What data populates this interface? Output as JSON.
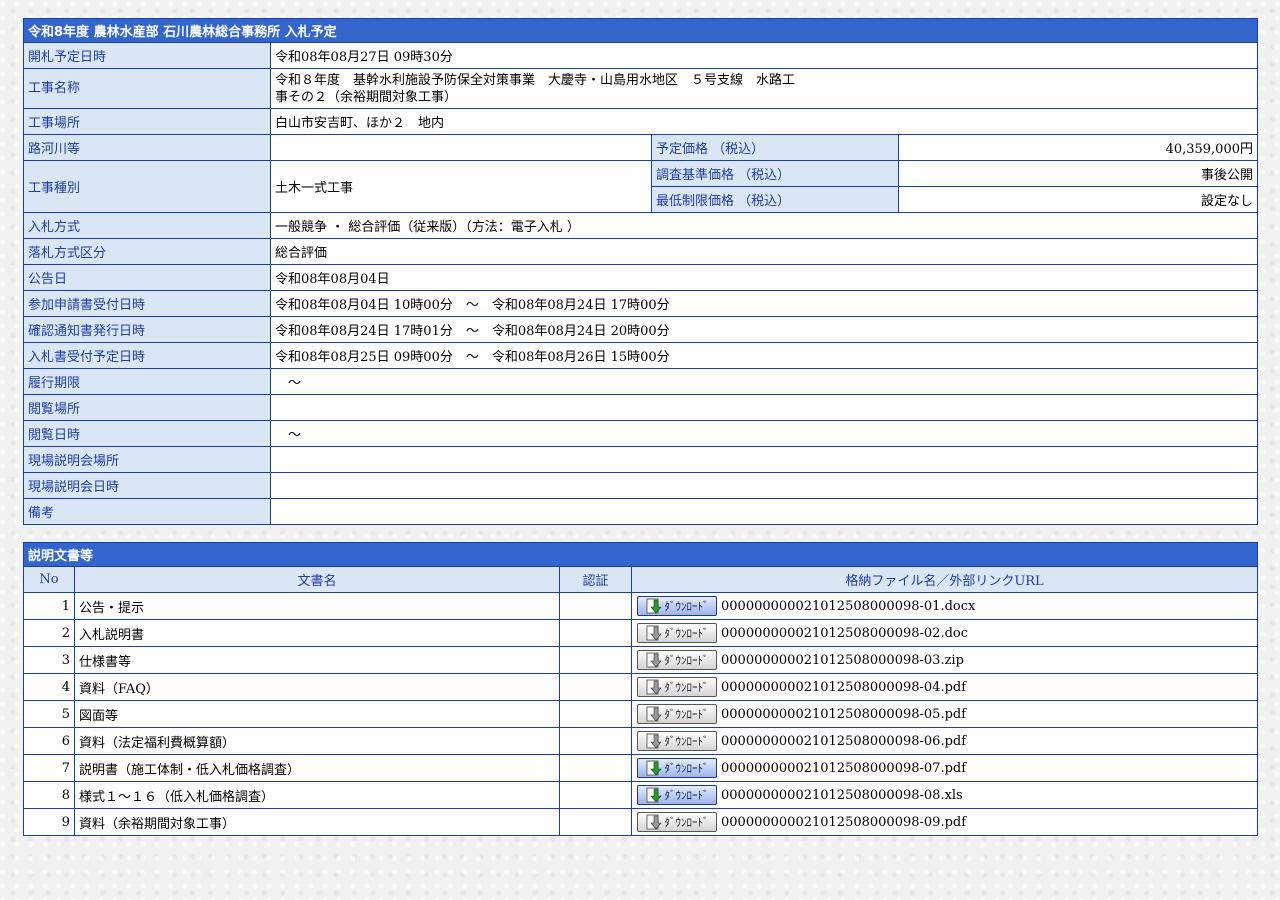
{
  "summary": {
    "title": "令和8年度 農林水産部 石川農林総合事務所 入札予定",
    "rows": {
      "opening": {
        "label": "開札予定日時",
        "value": "令和08年08月27日 09時30分"
      },
      "name": {
        "label": "工事名称",
        "value_line1": "令和８年度　基幹水利施設予防保全対策事業　大慶寺・山島用水地区　５号支線　水路工",
        "value_line2": "事その２（余裕期間対象工事）"
      },
      "place": {
        "label": "工事場所",
        "value": "白山市安吉町、ほか２　地内"
      },
      "river": {
        "label": "路河川等",
        "value": ""
      },
      "type": {
        "label": "工事種別",
        "value": "土木一式工事"
      },
      "price_est": {
        "label": "予定価格 （税込）",
        "value": "40,359,000円"
      },
      "price_survey": {
        "label": "調査基準価格 （税込）",
        "value": "事後公開"
      },
      "price_min": {
        "label": "最低制限価格 （税込）",
        "value": "設定なし"
      },
      "method": {
        "label": "入札方式",
        "value": "一般競争 ・ 総合評価（従来版）（方法：電子入札 ）"
      },
      "award": {
        "label": "落札方式区分",
        "value": "総合評価"
      },
      "notice": {
        "label": "公告日",
        "value": "令和08年08月04日"
      },
      "apply": {
        "label": "参加申請書受付日時",
        "value": "令和08年08月04日 10時00分　～　令和08年08月24日 17時00分"
      },
      "confirm": {
        "label": "確認通知書発行日時",
        "value": "令和08年08月24日 17時01分　～　令和08年08月24日 20時00分"
      },
      "receipt": {
        "label": "入札書受付予定日時",
        "value": "令和08年08月25日 09時00分　～　令和08年08月26日 15時00分"
      },
      "period": {
        "label": "履行期限",
        "value": "　～"
      },
      "view_place": {
        "label": "閲覧場所",
        "value": ""
      },
      "view_date": {
        "label": "閲覧日時",
        "value": "　～"
      },
      "site_place": {
        "label": "現場説明会場所",
        "value": ""
      },
      "site_date": {
        "label": "現場説明会日時",
        "value": ""
      },
      "note": {
        "label": "備考",
        "value": ""
      }
    }
  },
  "docs": {
    "title": "説明文書等",
    "headers": {
      "no": "No",
      "name": "文書名",
      "cert": "認証",
      "file": "格納ファイル名／外部リンクURL"
    },
    "download_label": "ﾀﾞｳﾝﾛｰﾄﾞ",
    "items": [
      {
        "no": "1",
        "name": "公告・提示",
        "file": "000000000021012508000098-01.docx",
        "active": true
      },
      {
        "no": "2",
        "name": "入札説明書",
        "file": "000000000021012508000098-02.doc",
        "active": false
      },
      {
        "no": "3",
        "name": "仕様書等",
        "file": "000000000021012508000098-03.zip",
        "active": false
      },
      {
        "no": "4",
        "name": "資料（FAQ）",
        "file": "000000000021012508000098-04.pdf",
        "active": false
      },
      {
        "no": "5",
        "name": "図面等",
        "file": "000000000021012508000098-05.pdf",
        "active": false
      },
      {
        "no": "6",
        "name": "資料（法定福利費概算額）",
        "file": "000000000021012508000098-06.pdf",
        "active": false
      },
      {
        "no": "7",
        "name": "説明書（施工体制・低入札価格調査）",
        "file": "000000000021012508000098-07.pdf",
        "active": true
      },
      {
        "no": "8",
        "name": "様式１～１６（低入札価格調査）",
        "file": "000000000021012508000098-08.xls",
        "active": true
      },
      {
        "no": "9",
        "name": "資料（余裕期間対象工事）",
        "file": "000000000021012508000098-09.pdf",
        "active": false
      }
    ]
  },
  "colors": {
    "header_blue": "#3366cc",
    "label_bg": "#dbe6f5",
    "border": "#1b3ea6"
  }
}
